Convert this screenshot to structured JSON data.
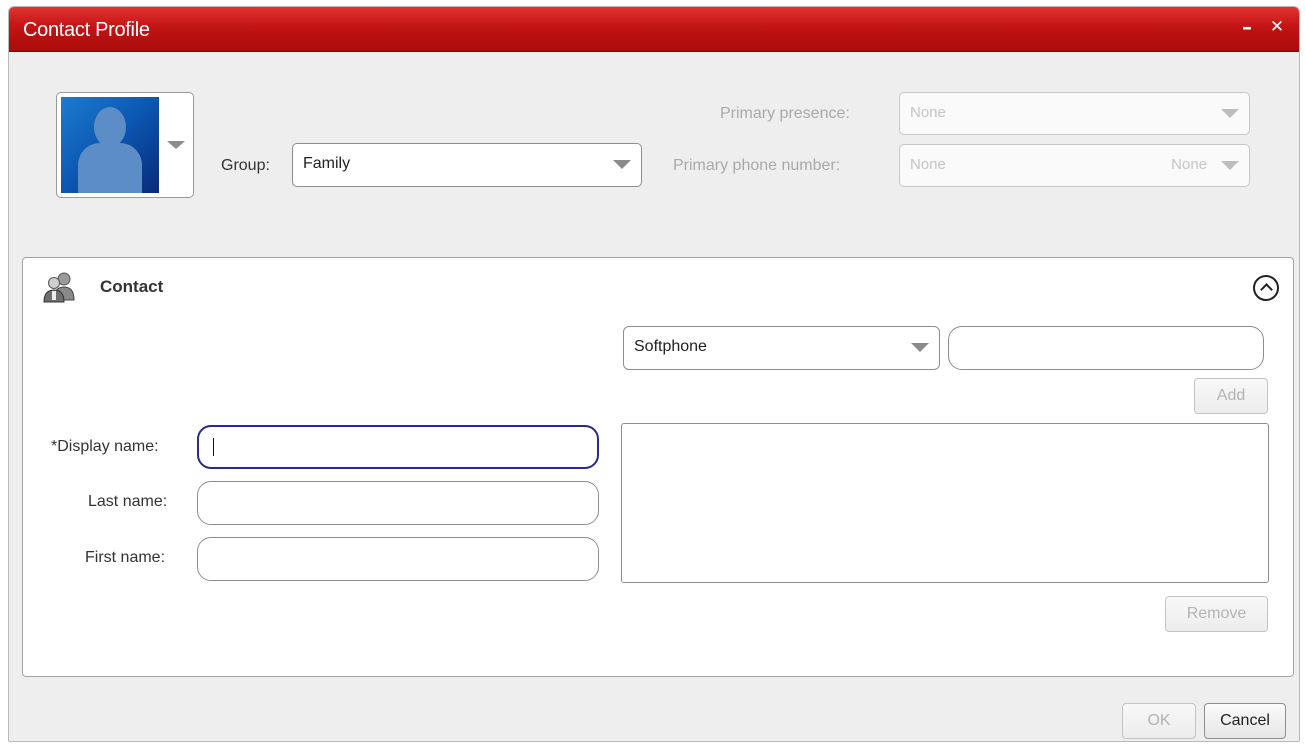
{
  "window": {
    "title": "Contact Profile",
    "minimize_glyph": "–",
    "close_glyph": "✕"
  },
  "header": {
    "avatar_icon": "person-silhouette-icon",
    "group_label": "Group:",
    "group_value": "Family",
    "primary_presence_label": "Primary presence:",
    "primary_presence_value": "None",
    "primary_phone_label": "Primary phone number:",
    "primary_phone_value": "None",
    "primary_phone_type": "None"
  },
  "contact": {
    "section_title": "Contact",
    "section_icon": "contacts-group-icon",
    "collapse_icon": "chevron-up-circle-icon",
    "phone_type_value": "Softphone",
    "phone_number_value": "",
    "add_label": "Add",
    "remove_label": "Remove",
    "display_name_label": "*Display name:",
    "display_name_value": "",
    "last_name_label": "Last name:",
    "last_name_value": "",
    "first_name_label": "First name:",
    "first_name_value": ""
  },
  "footer": {
    "ok_label": "OK",
    "cancel_label": "Cancel"
  },
  "colors": {
    "titlebar": "#c21414",
    "focus_border": "#2a2a8a",
    "background": "#eeeeee"
  }
}
